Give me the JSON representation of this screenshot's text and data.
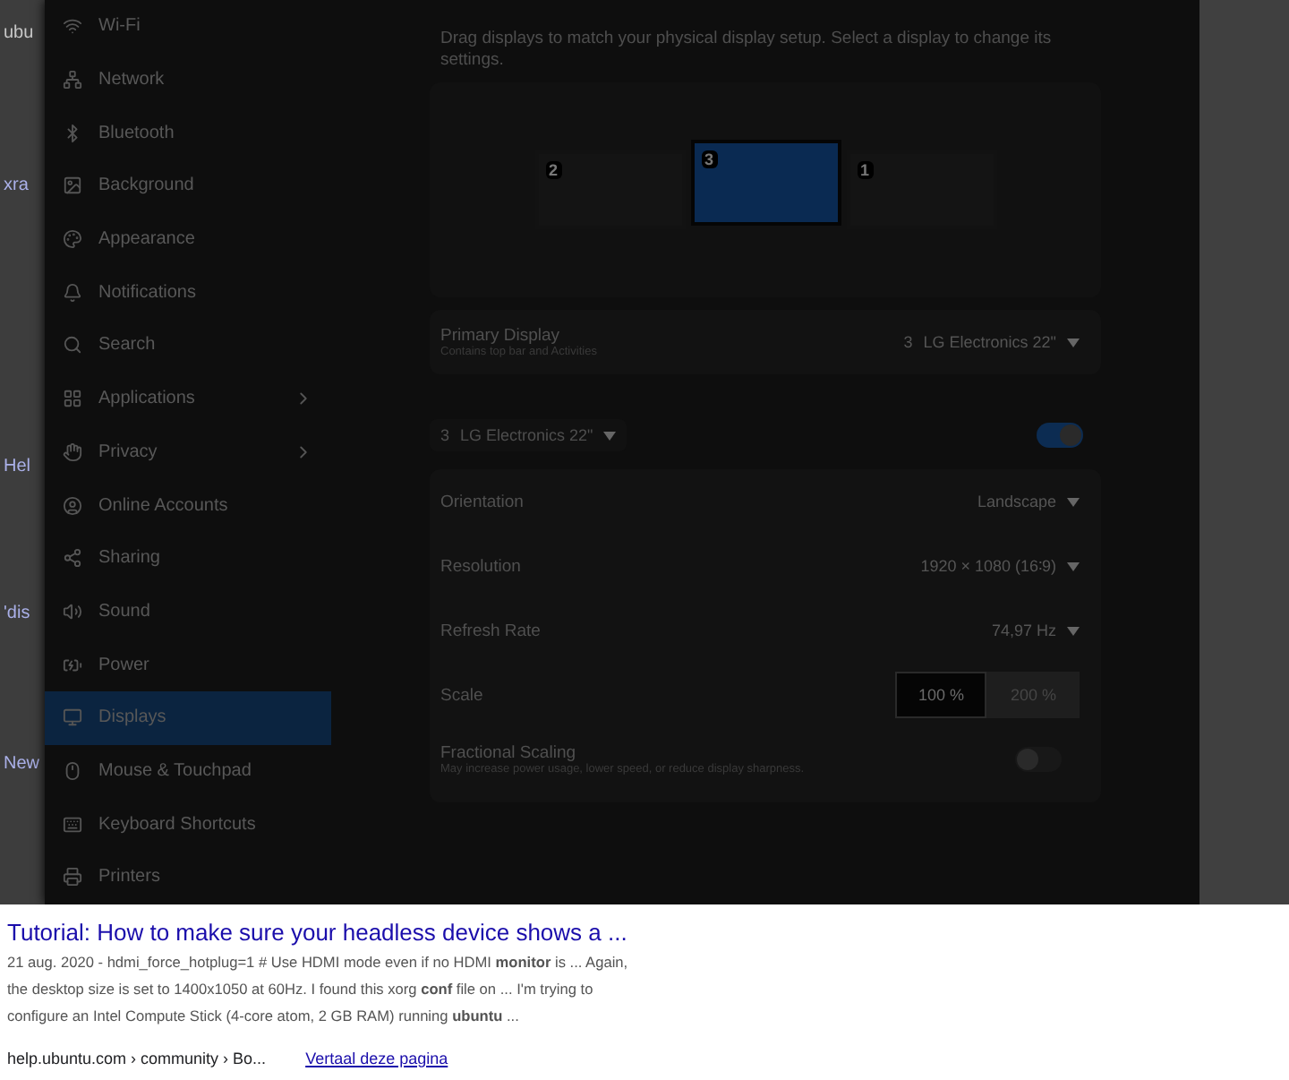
{
  "background_page": {
    "edge_fragments": [
      {
        "text": "ubu",
        "kind": "field"
      },
      {
        "text": "xra",
        "kind": "link"
      },
      {
        "text": "Hel",
        "kind": "link"
      },
      {
        "text": "'dis",
        "kind": "link"
      },
      {
        "text": "New",
        "kind": "link"
      }
    ],
    "result": {
      "title": "Tutorial: How to make sure your headless device shows a ...",
      "snippet": [
        "21 aug. 2020 - hdmi_force_hotplug=1 # Use HDMI mode even if no HDMI **monitor** is ... Again,",
        "the desktop size is set to 1400x1050 at 60Hz. I found this xorg **conf** file on ... I'm trying to",
        "configure an Intel Compute Stick (4-core atom, 2 GB RAM) running **ubuntu** ..."
      ]
    },
    "next_result": {
      "breadcrumb": "help.ubuntu.com › community › Bo...",
      "translate": "Vertaal deze pagina"
    }
  },
  "settings": {
    "sidebar": {
      "items": [
        {
          "label": "Wi-Fi",
          "selected": false,
          "chevron": false
        },
        {
          "label": "Network",
          "selected": false,
          "chevron": false
        },
        {
          "label": "Bluetooth",
          "selected": false,
          "chevron": false
        },
        {
          "label": "Background",
          "selected": false,
          "chevron": false
        },
        {
          "label": "Appearance",
          "selected": false,
          "chevron": false
        },
        {
          "label": "Notifications",
          "selected": false,
          "chevron": false
        },
        {
          "label": "Search",
          "selected": false,
          "chevron": false
        },
        {
          "label": "Applications",
          "selected": false,
          "chevron": true
        },
        {
          "label": "Privacy",
          "selected": false,
          "chevron": true
        },
        {
          "label": "Online Accounts",
          "selected": false,
          "chevron": false
        },
        {
          "label": "Sharing",
          "selected": false,
          "chevron": false
        },
        {
          "label": "Sound",
          "selected": false,
          "chevron": false
        },
        {
          "label": "Power",
          "selected": false,
          "chevron": false
        },
        {
          "label": "Displays",
          "selected": true,
          "chevron": false
        },
        {
          "label": "Mouse & Touchpad",
          "selected": false,
          "chevron": false
        },
        {
          "label": "Keyboard Shortcuts",
          "selected": false,
          "chevron": false
        },
        {
          "label": "Printers",
          "selected": false,
          "chevron": false
        }
      ]
    },
    "description": "Drag displays to match your physical display setup. Select a display to change its settings.",
    "arrangement": {
      "monitors": [
        {
          "number": "2",
          "selected": false
        },
        {
          "number": "3",
          "selected": true
        },
        {
          "number": "1",
          "selected": false
        }
      ]
    },
    "primary_display": {
      "label": "Primary Display",
      "subtitle": "Contains top bar and Activities",
      "number": "3",
      "name": "LG Electronics 22\""
    },
    "display_selector": {
      "number": "3",
      "name": "LG Electronics 22\"",
      "enabled": true
    },
    "rows": [
      {
        "kind": "dropdown",
        "label": "Orientation",
        "value": "Landscape"
      },
      {
        "kind": "dropdown",
        "label": "Resolution",
        "value": "1920 × 1080 (16∶9)"
      },
      {
        "kind": "dropdown",
        "label": "Refresh Rate",
        "value": "74,97 Hz"
      },
      {
        "kind": "choice",
        "label": "Scale",
        "options": [
          {
            "label": "100 %",
            "selected": true
          },
          {
            "label": "200 %",
            "selected": false
          }
        ]
      },
      {
        "kind": "switch",
        "label": "Fractional Scaling",
        "subtitle": "May increase power usage, lower speed, or reduce display sharpness.",
        "on": false
      }
    ]
  }
}
